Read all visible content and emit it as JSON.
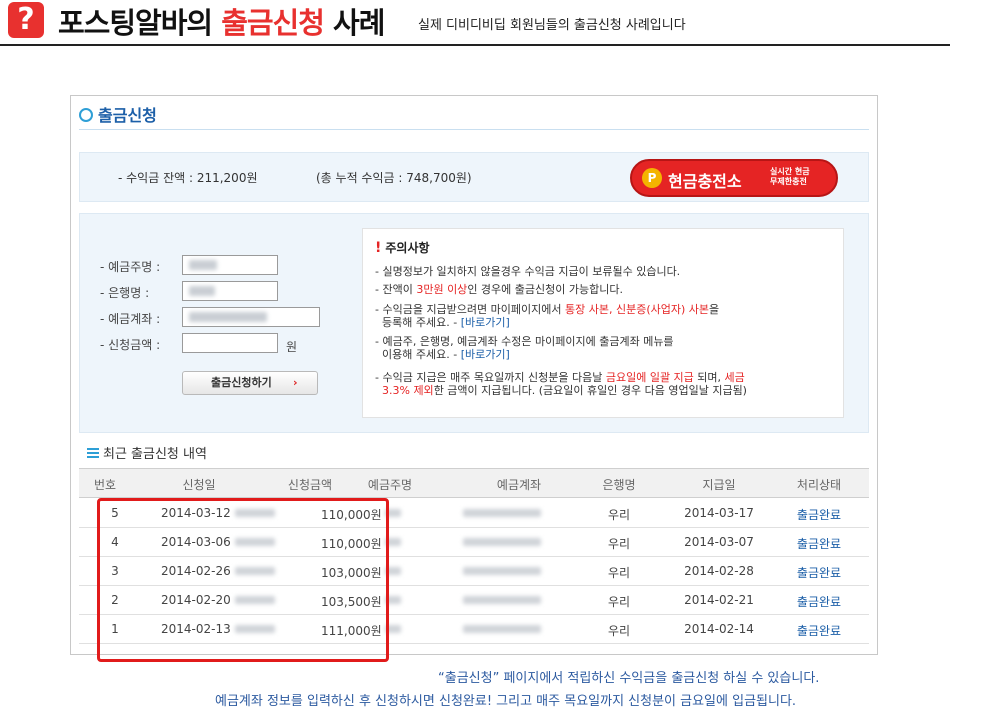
{
  "header": {
    "badge": "?",
    "title_part1": "포스팅알바의 ",
    "title_highlight": "출금신청",
    "title_part2": " 사례",
    "subtitle": "실제 디비디비딥 회원님들의 출금신청 사례입니다"
  },
  "panel": {
    "title": "출금신청",
    "balance": "- 수익금 잔액 : 211,200원",
    "total": "(총 누적 수익금 : 748,700원)",
    "cash_button": {
      "badge": "P",
      "label": "현금충전소",
      "sub_line1": "실시간 현금",
      "sub_line2": "무제한충전"
    }
  },
  "form": {
    "depositor_label": "- 예금주명 :",
    "bank_label": "- 은행명 :",
    "account_label": "- 예금계좌 :",
    "amount_label": "- 신청금액 :",
    "amount_value": "",
    "unit": "원",
    "apply_button": "출금신청하기",
    "apply_arrow": "›"
  },
  "notice": {
    "icon": "!",
    "title": "주의사항",
    "items": [
      {
        "a": "- 실명정보가 일치하지 않을경우 수익금 지급이 보류될수 있습니다."
      },
      {
        "a": "- 잔액이 ",
        "red": "3만원 이상",
        "b": "인 경우에 출금신청이 가능합니다."
      },
      {
        "a": "- 수익금을 지급받으려면 마이페이지에서 ",
        "red": "통장 사본, 신분증(사업자) 사본",
        "b": "을",
        "c": "등록해 주세요.  - ",
        "link": "[바로가기]"
      },
      {
        "a": "- 예금주, 은행명, 예금계좌 수정은 마이페이지에 출금계좌 메뉴를",
        "c": "이용해 주세요.  - ",
        "link": "[바로가기]"
      },
      {
        "a": "- 수익금 지급은 매주 목요일까지 신청분을 다음날 ",
        "red": "금요일에 일괄 지급",
        "b": " 되며, ",
        "red2": "세금",
        "red3": "3.3% 제외",
        "c": "한 금액이 지급됩니다. (금요일이 휴일인 경우 다음 영업일날 지급됨)"
      }
    ]
  },
  "history": {
    "title": "최근 출금신청 내역",
    "columns": [
      "번호",
      "신청일",
      "신청금액",
      "예금주명",
      "예금계좌",
      "은행명",
      "지급일",
      "처리상태"
    ],
    "rows": [
      {
        "no": "5",
        "date": "2014-03-12",
        "amount": "110,000원",
        "bank": "우리",
        "paid": "2014-03-17",
        "status": "출금완료"
      },
      {
        "no": "4",
        "date": "2014-03-06",
        "amount": "110,000원",
        "bank": "우리",
        "paid": "2014-03-07",
        "status": "출금완료"
      },
      {
        "no": "3",
        "date": "2014-02-26",
        "amount": "103,000원",
        "bank": "우리",
        "paid": "2014-02-28",
        "status": "출금완료"
      },
      {
        "no": "2",
        "date": "2014-02-20",
        "amount": "103,500원",
        "bank": "우리",
        "paid": "2014-02-21",
        "status": "출금완료"
      },
      {
        "no": "1",
        "date": "2014-02-13",
        "amount": "111,000원",
        "bank": "우리",
        "paid": "2014-02-14",
        "status": "출금완료"
      }
    ]
  },
  "footer": {
    "line1": "“출금신청”  페이지에서 적립하신 수익금을 출금신청 하실 수 있습니다.",
    "line2": "예금계좌 정보를 입력하신 후 신청하시면 신청완료! 그리고 매주 목요일까지 신청분이 금요일에 입금됩니다."
  },
  "colors": {
    "accent_red": "#e52424",
    "link_blue": "#1c5fa8",
    "panel_bg": "#eef5fb"
  }
}
